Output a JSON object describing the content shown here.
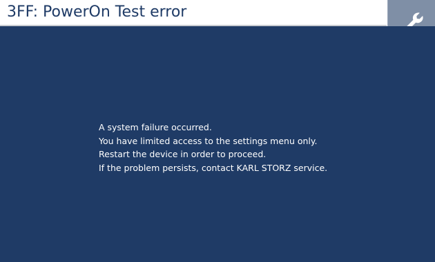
{
  "header": {
    "title": "3FF: PowerOn Test error"
  },
  "toolbar": {
    "settings_icon": "wrench-icon"
  },
  "message": {
    "lines": [
      "A system failure occurred.",
      "You have limited access to the settings menu only.",
      "Restart the device in order to proceed.",
      "If the problem persists, contact KARL STORZ service."
    ]
  },
  "colors": {
    "background": "#1f3b66",
    "title_bar": "#ffffff",
    "title_text": "#1f3b66",
    "settings_button": "#7f8fa6",
    "message_text": "#ffffff"
  }
}
